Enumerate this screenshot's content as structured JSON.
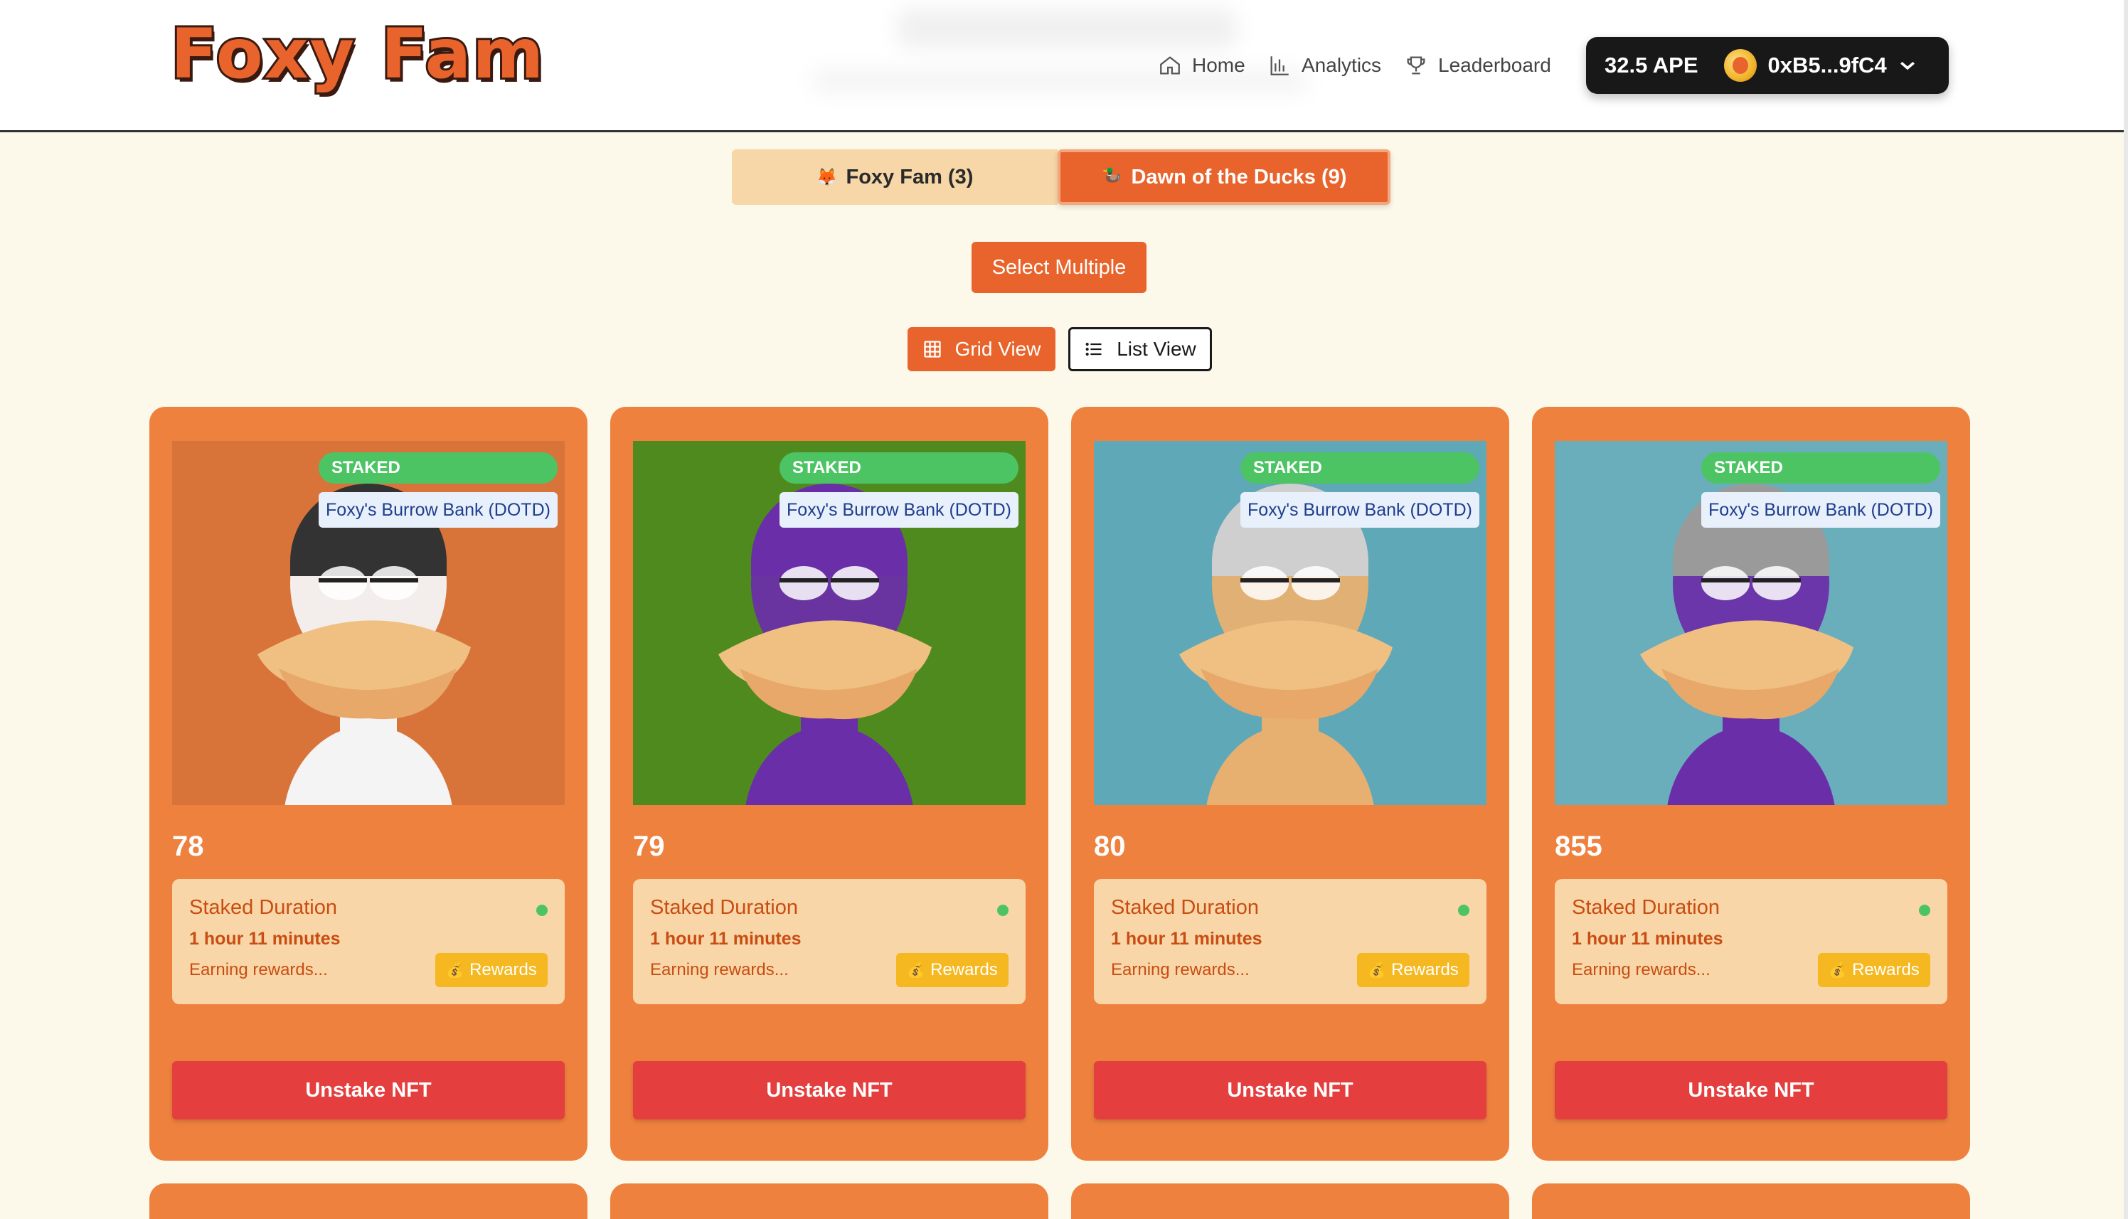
{
  "app": {
    "logo_text": "Foxy Fam"
  },
  "nav": {
    "home": {
      "label": "Home",
      "icon": "home-icon"
    },
    "analytics": {
      "label": "Analytics",
      "icon": "bar-chart-icon"
    },
    "leaderboard": {
      "label": "Leaderboard",
      "icon": "trophy-icon"
    }
  },
  "wallet": {
    "balance": "32.5 APE",
    "address": "0xB5...9fC4"
  },
  "collections": {
    "foxy": {
      "emoji": "🦊",
      "label": "Foxy Fam (3)"
    },
    "ducks": {
      "emoji": "🦆",
      "label": "Dawn of the Ducks (9)"
    }
  },
  "actions": {
    "select_multiple": "Select Multiple"
  },
  "view_toggle": {
    "grid": "Grid View",
    "list": "List View"
  },
  "cards": [
    {
      "id": "78",
      "status": "STAKED",
      "pool": "Foxy's Burrow Bank (DOTD)",
      "duration_label": "Staked Duration",
      "duration": "1 hour 11 minutes",
      "earning": "Earning rewards...",
      "rewards_label": "Rewards",
      "unstake_label": "Unstake NFT",
      "bg_color": "#d8743a",
      "body_color": "#f4f4f4",
      "hat_color": "#333333"
    },
    {
      "id": "79",
      "status": "STAKED",
      "pool": "Foxy's Burrow Bank (DOTD)",
      "duration_label": "Staked Duration",
      "duration": "1 hour 11 minutes",
      "earning": "Earning rewards...",
      "rewards_label": "Rewards",
      "unstake_label": "Unstake NFT",
      "bg_color": "#4f8a1e",
      "body_color": "#6a2fa8",
      "hat_color": "#6a2fa8"
    },
    {
      "id": "80",
      "status": "STAKED",
      "pool": "Foxy's Burrow Bank (DOTD)",
      "duration_label": "Staked Duration",
      "duration": "1 hour 11 minutes",
      "earning": "Earning rewards...",
      "rewards_label": "Rewards",
      "unstake_label": "Unstake NFT",
      "bg_color": "#5fa8b8",
      "body_color": "#e8b070",
      "hat_color": "#cfcfcf"
    },
    {
      "id": "855",
      "status": "STAKED",
      "pool": "Foxy's Burrow Bank (DOTD)",
      "duration_label": "Staked Duration",
      "duration": "1 hour 11 minutes",
      "earning": "Earning rewards...",
      "rewards_label": "Rewards",
      "unstake_label": "Unstake NFT",
      "bg_color": "#6aaebc",
      "body_color": "#6a2fa8",
      "hat_color": "#9a9a9a"
    }
  ],
  "colors": {
    "accent": "#e8642c",
    "card": "#ee813e",
    "staked_green": "#4cc463",
    "unstake_red": "#e53e3e",
    "rewards_yellow": "#f6b821",
    "page_bg": "#fdf9ea"
  }
}
